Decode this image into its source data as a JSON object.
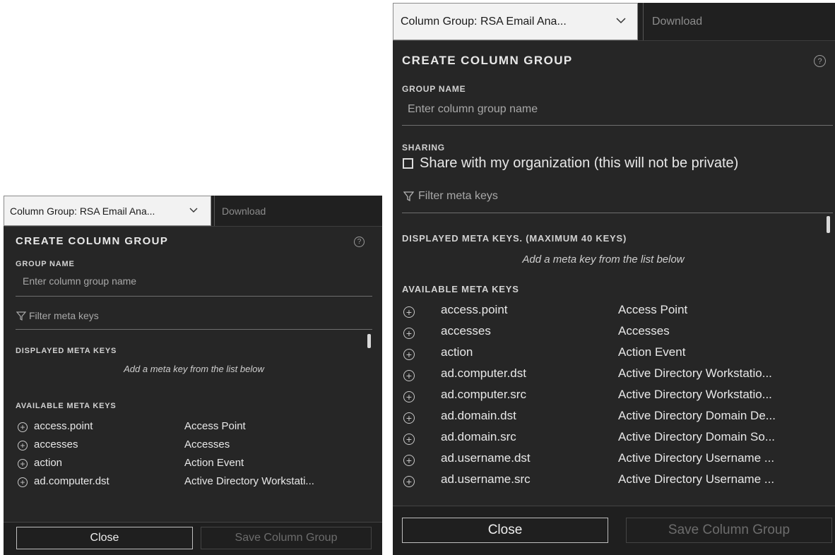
{
  "toolbar": {
    "column_group_label": "Column Group: RSA Email Ana...",
    "download_placeholder": "Download"
  },
  "dialog": {
    "title": "CREATE COLUMN GROUP",
    "help_icon": "?",
    "group_name_label": "GROUP NAME",
    "group_name_placeholder": "Enter column group name",
    "sharing_label": "SHARING",
    "share_checkbox_label": "Share with my organization (this will not be private)",
    "share_checked": false,
    "filter_placeholder": "Filter meta keys",
    "displayed_label_compact": "DISPLAYED META KEYS",
    "displayed_label_full": "DISPLAYED META KEYS. (MAXIMUM 40 KEYS)",
    "displayed_hint": "Add a meta key from the list below",
    "available_label": "AVAILABLE META KEYS",
    "close_label": "Close",
    "save_label": "Save Column Group"
  },
  "compact": {
    "available_keys": [
      {
        "key": "access.point",
        "name": "Access Point"
      },
      {
        "key": "accesses",
        "name": "Accesses"
      },
      {
        "key": "action",
        "name": "Action Event"
      },
      {
        "key": "ad.computer.dst",
        "name": "Active Directory Workstati..."
      }
    ]
  },
  "expanded": {
    "available_keys": [
      {
        "key": "access.point",
        "name": "Access Point"
      },
      {
        "key": "accesses",
        "name": "Accesses"
      },
      {
        "key": "action",
        "name": "Action Event"
      },
      {
        "key": "ad.computer.dst",
        "name": "Active Directory Workstatio..."
      },
      {
        "key": "ad.computer.src",
        "name": "Active Directory Workstatio..."
      },
      {
        "key": "ad.domain.dst",
        "name": "Active Directory Domain De..."
      },
      {
        "key": "ad.domain.src",
        "name": "Active Directory Domain So..."
      },
      {
        "key": "ad.username.dst",
        "name": "Active Directory Username ..."
      },
      {
        "key": "ad.username.src",
        "name": "Active Directory Username ..."
      }
    ]
  },
  "icons": {
    "chevron": "chevron-down-icon",
    "filter": "filter-icon",
    "add": "add-circle-icon",
    "help": "help-icon",
    "checkbox": "checkbox-icon"
  }
}
